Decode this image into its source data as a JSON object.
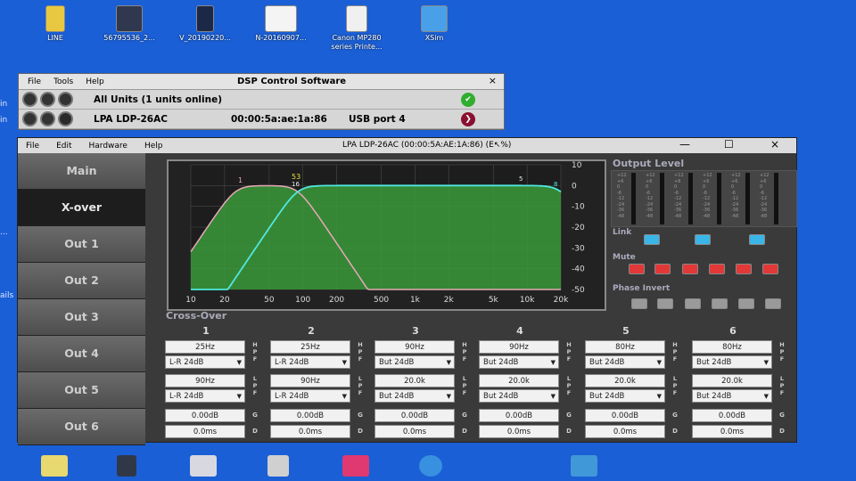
{
  "desktop": {
    "icons": [
      {
        "label": "LINE"
      },
      {
        "label": "56795536_2..."
      },
      {
        "label": "V_20190220..."
      },
      {
        "label": "N-20160907..."
      },
      {
        "label": "Canon MP280 series Printe..."
      },
      {
        "label": "XSim"
      }
    ],
    "side_text": [
      "in",
      "in",
      "...",
      "ails"
    ]
  },
  "control_window": {
    "menu": [
      "File",
      "Tools",
      "Help"
    ],
    "title": "DSP Control Software",
    "close": "×",
    "rows": [
      {
        "name": "All Units (1 units online)",
        "mac": "",
        "port": "",
        "status_color": "#2fae2f"
      },
      {
        "name": "LPA LDP-26AC",
        "mac": "00:00:5a:ae:1a:86",
        "port": "USB port 4",
        "status_color": "#8a1030"
      }
    ]
  },
  "main_window": {
    "menu": [
      "File",
      "Edit",
      "Hardware",
      "Help"
    ],
    "title": "LPA LDP-26AC (00:00:5A:AE:1A:86) (E",
    "title_tail": "%)",
    "min": "—",
    "max": "☐",
    "close": "×",
    "nav": [
      {
        "label": "Main",
        "active": false
      },
      {
        "label": "X-over",
        "active": true
      },
      {
        "label": "Out 1",
        "active": false
      },
      {
        "label": "Out 2",
        "active": false
      },
      {
        "label": "Out 3",
        "active": false
      },
      {
        "label": "Out 4",
        "active": false
      },
      {
        "label": "Out 5",
        "active": false
      },
      {
        "label": "Out 6",
        "active": false
      }
    ],
    "graph": {
      "x_ticks": [
        "10",
        "20",
        "50",
        "100",
        "200",
        "500",
        "1k",
        "2k",
        "5k",
        "10k",
        "20k"
      ],
      "y_ticks": [
        "10",
        "0",
        "-10",
        "-20",
        "-30",
        "-40",
        "-50"
      ],
      "markers": [
        "1",
        "53",
        "16",
        "5",
        "8"
      ]
    },
    "output_level_label": "Output Level",
    "meter_scale": [
      "+12",
      "+6",
      "0",
      "-6",
      "-12",
      "-24",
      "-36",
      "-48"
    ],
    "link_label": "Link",
    "mute_label": "Mute",
    "phase_label": "Phase Invert",
    "crossover_label": "Cross-Over",
    "hpf_tag": [
      "H",
      "P",
      "F"
    ],
    "lpf_tag": [
      "L",
      "P",
      "F"
    ],
    "g_tag": "G",
    "d_tag": "D",
    "channels": [
      {
        "num": "1",
        "hpf_freq": "25Hz",
        "hpf_type": "L-R 24dB",
        "lpf_freq": "90Hz",
        "lpf_type": "L-R 24dB",
        "gain": "0.00dB",
        "delay": "0.0ms"
      },
      {
        "num": "2",
        "hpf_freq": "25Hz",
        "hpf_type": "L-R 24dB",
        "lpf_freq": "90Hz",
        "lpf_type": "L-R 24dB",
        "gain": "0.00dB",
        "delay": "0.0ms"
      },
      {
        "num": "3",
        "hpf_freq": "90Hz",
        "hpf_type": "But 24dB",
        "lpf_freq": "20.0k",
        "lpf_type": "But 24dB",
        "gain": "0.00dB",
        "delay": "0.0ms"
      },
      {
        "num": "4",
        "hpf_freq": "90Hz",
        "hpf_type": "But 24dB",
        "lpf_freq": "20.0k",
        "lpf_type": "But 24dB",
        "gain": "0.00dB",
        "delay": "0.0ms"
      },
      {
        "num": "5",
        "hpf_freq": "80Hz",
        "hpf_type": "But 24dB",
        "lpf_freq": "20.0k",
        "lpf_type": "But 24dB",
        "gain": "0.00dB",
        "delay": "0.0ms"
      },
      {
        "num": "6",
        "hpf_freq": "80Hz",
        "hpf_type": "But 24dB",
        "lpf_freq": "20.0k",
        "lpf_type": "But 24dB",
        "gain": "0.00dB",
        "delay": "0.0ms"
      }
    ],
    "dropdown_arrow": "▼"
  },
  "colors": {
    "desktop": "#1a5fd6",
    "link_on": "#3ab5e8",
    "mute_on": "#e23838",
    "curve_low": "#e8a8b8",
    "curve_band": "#50e8e0",
    "curve_fill": "#3a9a3a"
  },
  "taskbar": {
    "icons": [
      {
        "name": "folder-icon",
        "color": "#e8d870"
      },
      {
        "name": "app-icon",
        "color": "#303848"
      },
      {
        "name": "doc-icon",
        "color": "#d8d8e0"
      },
      {
        "name": "image-icon",
        "color": "#d0d0d0"
      },
      {
        "name": "media-icon",
        "color": "#e03870"
      },
      {
        "name": "browser-icon",
        "color": "#3890e0"
      },
      {
        "name": "network-icon",
        "color": "#4098d8"
      }
    ]
  }
}
